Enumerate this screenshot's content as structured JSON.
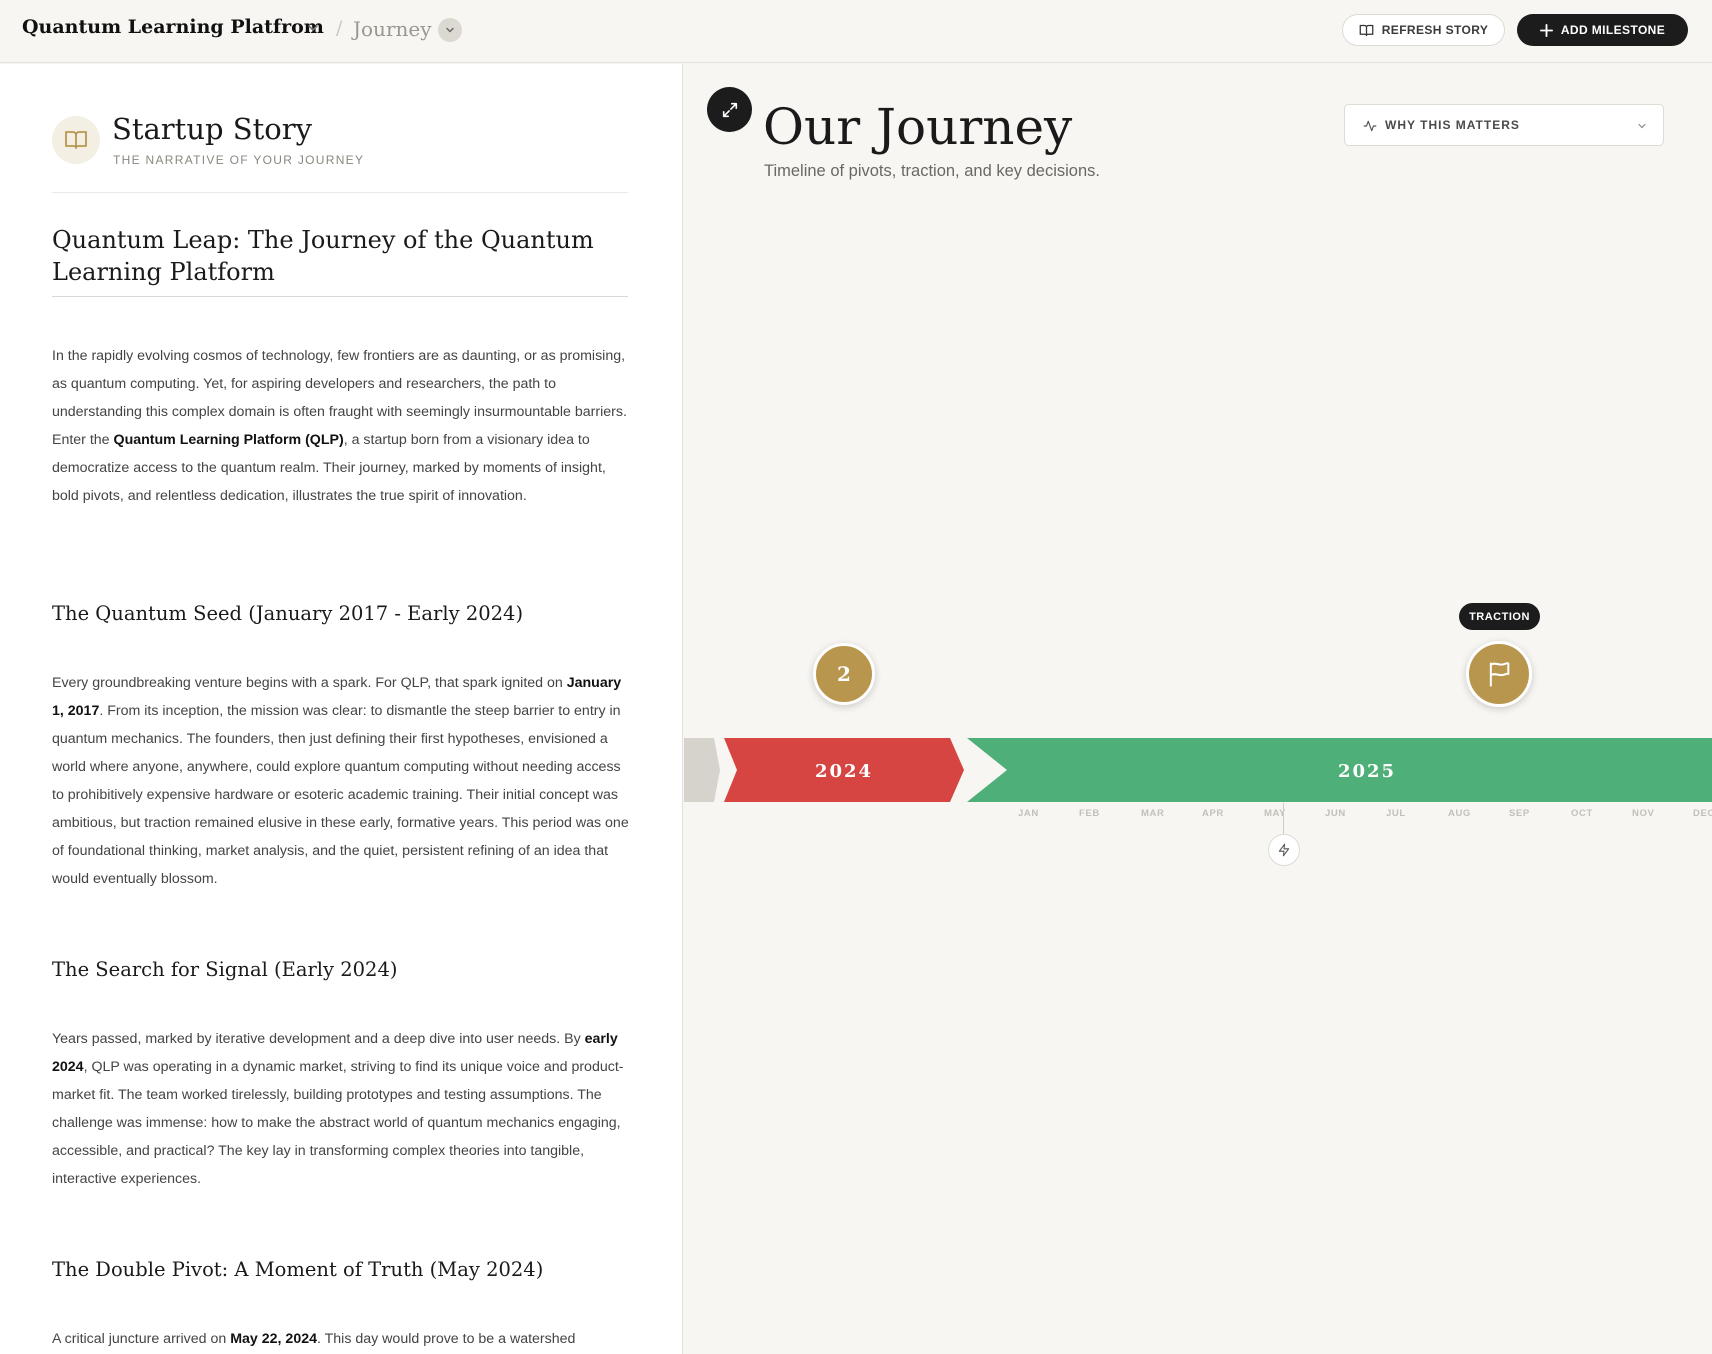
{
  "header": {
    "brand": "Quantum Learning Platfrom",
    "separator": "/",
    "breadcrumb": "Journey",
    "refresh_label": "REFRESH STORY",
    "add_label": "ADD MILESTONE"
  },
  "story": {
    "title": "Startup Story",
    "subtitle": "THE NARRATIVE OF YOUR JOURNEY",
    "doc_title": "Quantum Leap: The Journey of the Quantum Learning Platform",
    "intro": {
      "pre": "In the rapidly evolving cosmos of technology, few frontiers are as daunting, or as promising, as quantum computing. Yet, for aspiring developers and researchers, the path to understanding this complex domain is often fraught with seemingly insurmountable barriers. Enter the ",
      "bold": "Quantum Learning Platform (QLP)",
      "post": ", a startup born from a visionary idea to democratize access to the quantum realm. Their journey, marked by moments of insight, bold pivots, and relentless dedication, illustrates the true spirit of innovation."
    },
    "sections": [
      {
        "heading": "The Quantum Seed (January 2017 - Early 2024)",
        "pre": "Every groundbreaking venture begins with a spark. For QLP, that spark ignited on ",
        "bold": "January 1, 2017",
        "post": ". From its inception, the mission was clear: to dismantle the steep barrier to entry in quantum mechanics. The founders, then just defining their first hypotheses, envisioned a world where anyone, anywhere, could explore quantum computing without needing access to prohibitively expensive hardware or esoteric academic training. Their initial concept was ambitious, but traction remained elusive in these early, formative years. This period was one of foundational thinking, market analysis, and the quiet, persistent refining of an idea that would eventually blossom."
      },
      {
        "heading": "The Search for Signal (Early 2024)",
        "pre": "Years passed, marked by iterative development and a deep dive into user needs. By ",
        "bold": "early 2024",
        "post": ", QLP was operating in a dynamic market, striving to find its unique voice and product-market fit. The team worked tirelessly, building prototypes and testing assumptions. The challenge was immense: how to make the abstract world of quantum mechanics engaging, accessible, and practical? The key lay in transforming complex theories into tangible, interactive experiences."
      },
      {
        "heading": "The Double Pivot: A Moment of Truth (May 2024)",
        "pre": "A critical juncture arrived on ",
        "bold": "May 22, 2024",
        "post": ". This day would prove to be a watershed"
      }
    ]
  },
  "journey": {
    "title": "Our Journey",
    "subtitle": "Timeline of pivots, traction, and key decisions.",
    "why_label": "WHY THIS MATTERS",
    "years": [
      "2024",
      "2025"
    ],
    "months": [
      "JAN",
      "FEB",
      "MAR",
      "APR",
      "MAY",
      "JUN",
      "JUL",
      "AUG",
      "SEP",
      "OCT",
      "NOV",
      "DEC"
    ],
    "cluster_count": "2",
    "milestone_tag": "TRACTION",
    "colors": {
      "year_2024": "#d64541",
      "year_2025": "#4faf78",
      "past": "#d6d3cd",
      "milestone": "#b8964e"
    },
    "icons": {
      "brand_chevron": "chevron-down-icon",
      "refresh": "book-open-icon",
      "add": "plus-icon",
      "expand": "expand-icon",
      "why": "activity-icon",
      "milestone": "flag-icon",
      "marker": "lightning-icon"
    }
  }
}
